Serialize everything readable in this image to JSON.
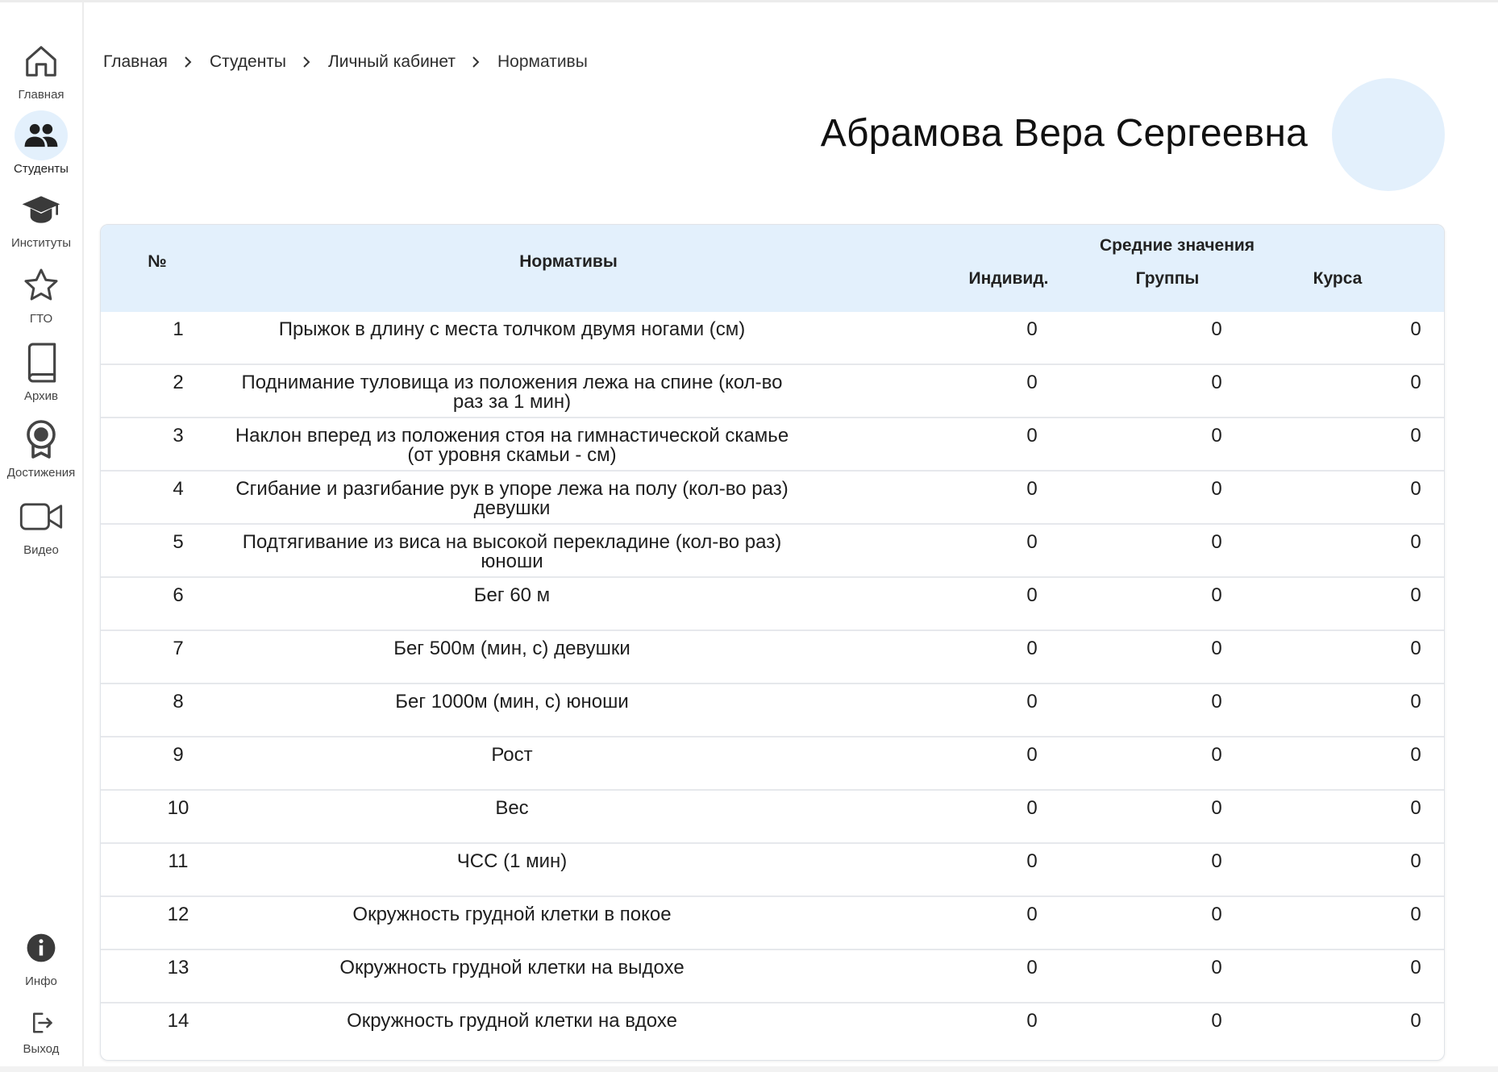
{
  "sidebar": {
    "items": [
      {
        "label": "Главная",
        "icon": "home-icon"
      },
      {
        "label": "Студенты",
        "icon": "users-icon",
        "active": true
      },
      {
        "label": "Институты",
        "icon": "graduation-cap-icon"
      },
      {
        "label": "ГТО",
        "icon": "star-icon"
      },
      {
        "label": "Архив",
        "icon": "book-icon"
      },
      {
        "label": "Достижения",
        "icon": "award-icon"
      },
      {
        "label": "Видео",
        "icon": "video-camera-icon"
      }
    ],
    "bottom_items": [
      {
        "label": "Инфо",
        "icon": "info-icon"
      },
      {
        "label": "Выход",
        "icon": "logout-icon"
      }
    ]
  },
  "breadcrumb": [
    "Главная",
    "Студенты",
    "Личный кабинет",
    "Нормативы"
  ],
  "student_name": "Абрамова Вера Сергеевна",
  "colors": {
    "accent_light": "#e3f0fc",
    "icon": "#444444"
  },
  "table": {
    "headers": {
      "num": "№",
      "norm": "Нормативы",
      "averages": "Средние значения",
      "individual": "Индивид.",
      "group": "Группы",
      "course": "Курса"
    },
    "rows": [
      {
        "num": "1",
        "norm": "Прыжок в длину с места толчком двумя ногами (см)",
        "ind": "0",
        "grp": "0",
        "crs": "0"
      },
      {
        "num": "2",
        "norm": "Поднимание туловища из положения лежа на спине (кол-во раз за 1 мин)",
        "ind": "0",
        "grp": "0",
        "crs": "0"
      },
      {
        "num": "3",
        "norm": "Наклон вперед из положения  стоя на гимнастической скамье (от уровня скамьи - см)",
        "ind": "0",
        "grp": "0",
        "crs": "0"
      },
      {
        "num": "4",
        "norm": "Сгибание и разгибание рук в упоре лежа на полу (кол-во раз) девушки",
        "ind": "0",
        "grp": "0",
        "crs": "0"
      },
      {
        "num": "5",
        "norm": "Подтягивание из виса на высокой перекладине (кол-во раз) юноши",
        "ind": "0",
        "grp": "0",
        "crs": "0"
      },
      {
        "num": "6",
        "norm": "Бег 60 м",
        "ind": "0",
        "grp": "0",
        "crs": "0"
      },
      {
        "num": "7",
        "norm": "Бег 500м (мин, с) девушки",
        "ind": "0",
        "grp": "0",
        "crs": "0"
      },
      {
        "num": "8",
        "norm": "Бег 1000м (мин, с) юноши",
        "ind": "0",
        "grp": "0",
        "crs": "0"
      },
      {
        "num": "9",
        "norm": "Рост",
        "ind": "0",
        "grp": "0",
        "crs": "0"
      },
      {
        "num": "10",
        "norm": "Вес",
        "ind": "0",
        "grp": "0",
        "crs": "0"
      },
      {
        "num": "11",
        "norm": "ЧСС (1 мин)",
        "ind": "0",
        "grp": "0",
        "crs": "0"
      },
      {
        "num": "12",
        "norm": "Окружность грудной клетки в покое",
        "ind": "0",
        "grp": "0",
        "crs": "0"
      },
      {
        "num": "13",
        "norm": "Окружность грудной клетки на выдохе",
        "ind": "0",
        "grp": "0",
        "crs": "0"
      },
      {
        "num": "14",
        "norm": "Окружность грудной клетки на вдохе",
        "ind": "0",
        "grp": "0",
        "crs": "0"
      }
    ]
  }
}
